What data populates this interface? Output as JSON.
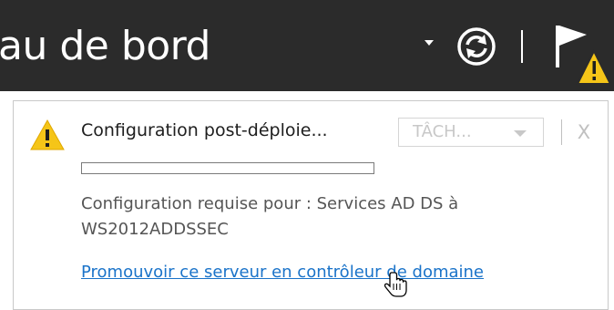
{
  "header": {
    "title": "au de bord",
    "icons": {
      "dropdown": "caret-down-icon",
      "refresh": "refresh-icon",
      "notifications": "flag-warning-icon"
    }
  },
  "notification": {
    "title": "Configuration post-déploie...",
    "tasks_label": "TÂCH...",
    "close_label": "X",
    "progress": 0,
    "description": "Configuration requise pour : Services AD DS à WS2012ADDSSEC",
    "link_text": "Promouvoir ce serveur en contrôleur de domaine"
  },
  "colors": {
    "header_bg": "#2b2b2b",
    "warning": "#f5c518",
    "link": "#1a73c9"
  }
}
